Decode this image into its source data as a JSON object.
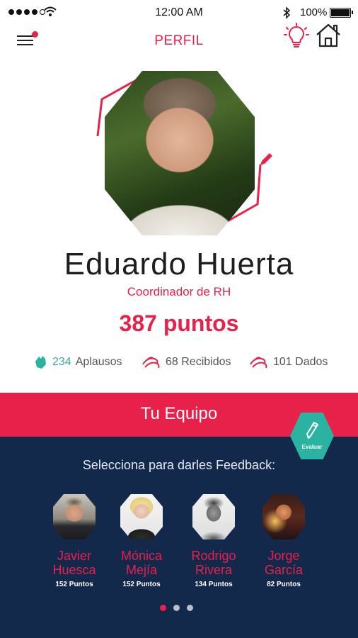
{
  "status_bar": {
    "time": "12:00 AM",
    "battery": "100%",
    "icons": [
      "signal-icon",
      "wifi-icon",
      "bluetooth-icon",
      "battery-icon"
    ]
  },
  "header": {
    "title": "PERFIL",
    "icons": [
      "menu-icon",
      "lightbulb-icon",
      "home-icon"
    ]
  },
  "profile": {
    "name": "Eduardo Huerta",
    "role": "Coordinador de RH",
    "points": "387 puntos",
    "stats": {
      "applause_count": "234",
      "applause_label": "Aplausos",
      "received": "68 Recibidos",
      "given": "101 Dados"
    }
  },
  "team": {
    "title": "Tu Equipo",
    "evaluate_label": "Evaluar",
    "prompt": "Selecciona para darles Feedback:",
    "members": [
      {
        "name": "Javier\nHuesca",
        "points": "152 Puntos"
      },
      {
        "name": "Mónica\nMejía",
        "points": "152 Puntos"
      },
      {
        "name": "Rodrigo\nRivera",
        "points": "134 Puntos"
      },
      {
        "name": "Jorge\nGarcía",
        "points": "82 Puntos"
      }
    ],
    "pages": 3,
    "current_page": 1
  },
  "colors": {
    "accent": "#e8214b",
    "navy": "#13294b",
    "teal": "#2bb3a1"
  }
}
